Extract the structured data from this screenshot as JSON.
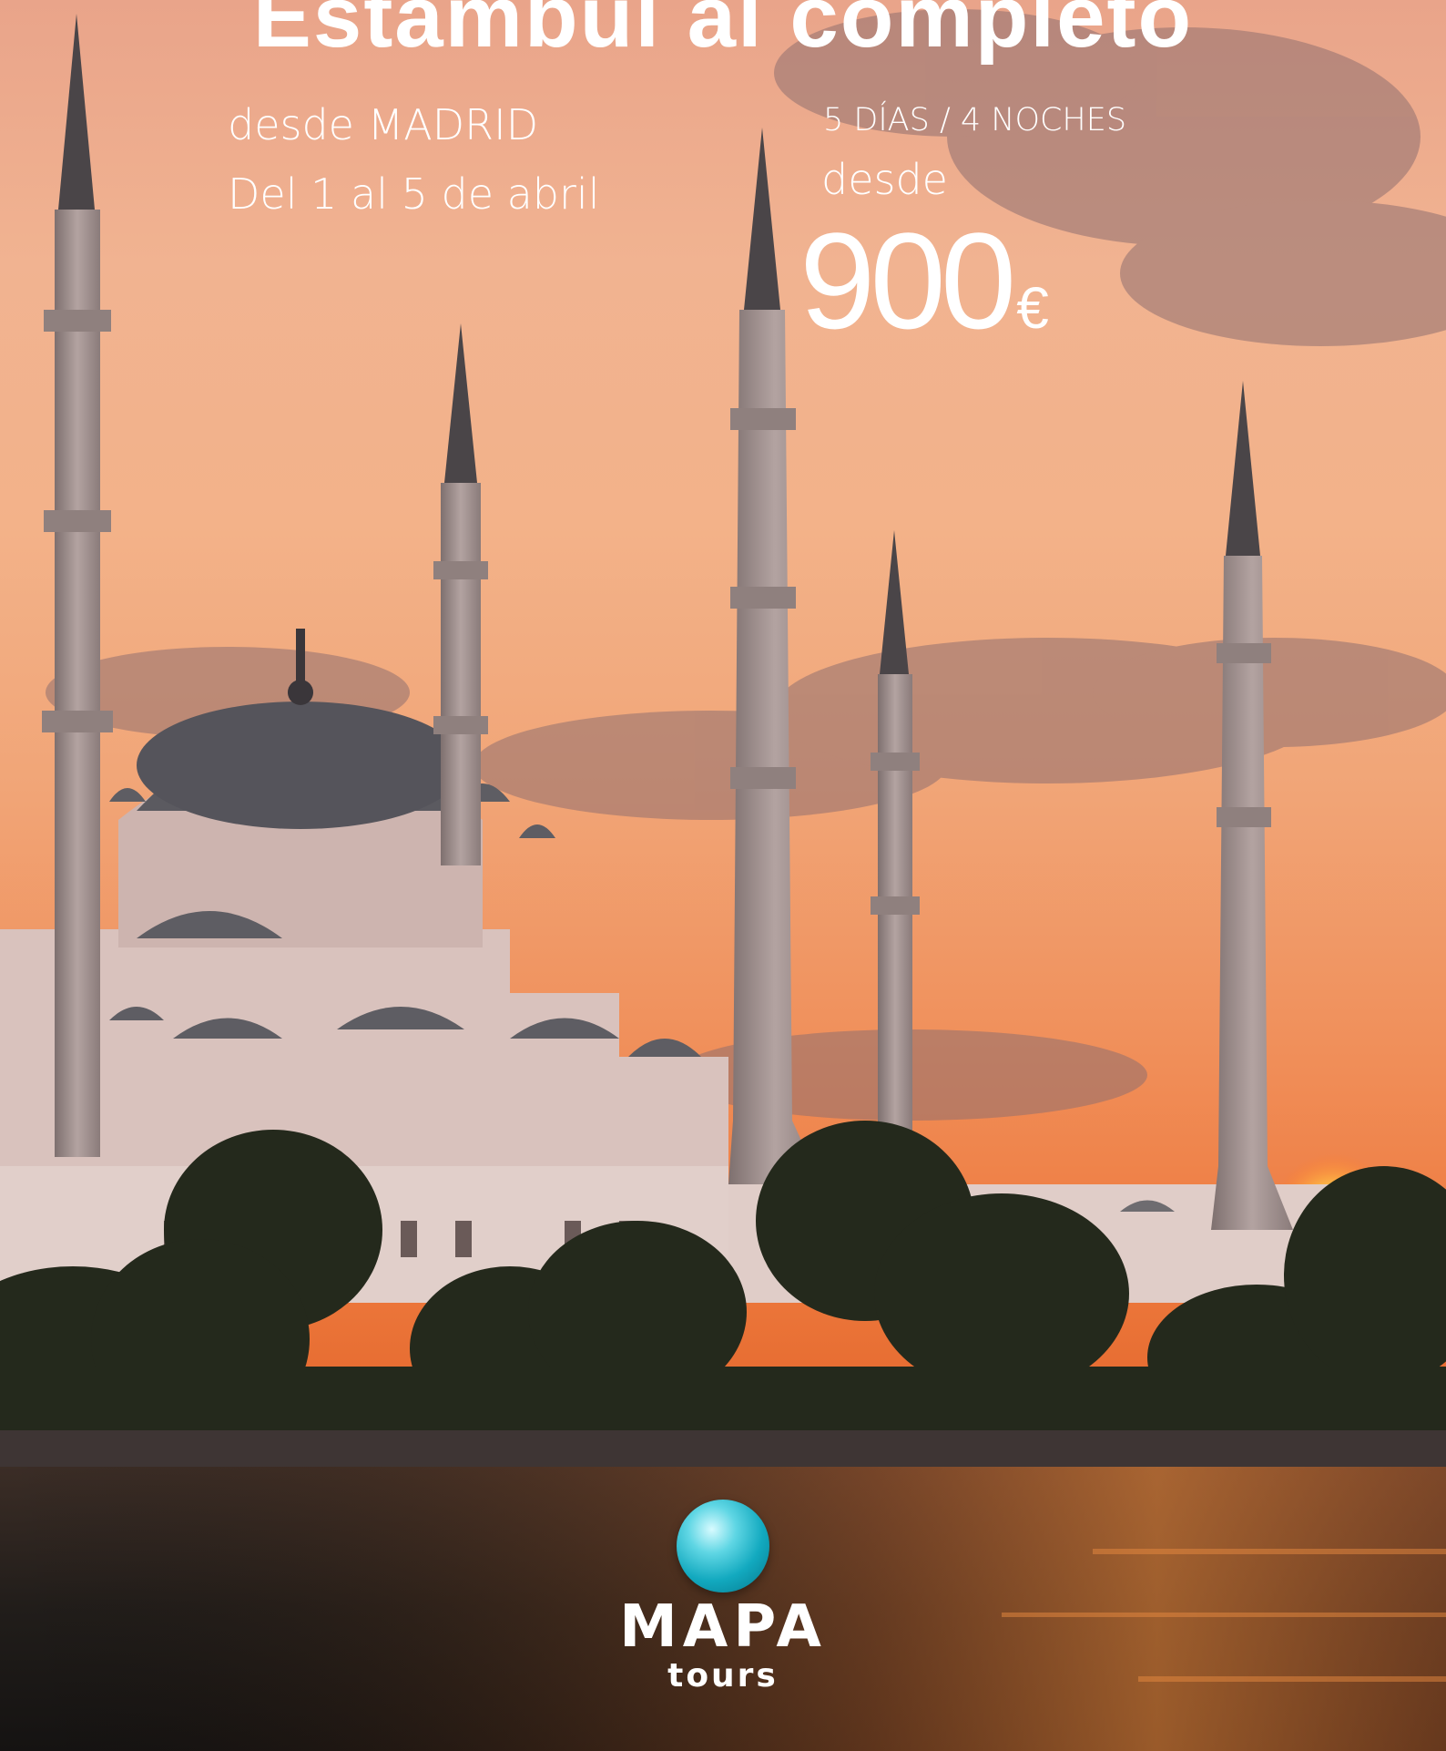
{
  "headline": {
    "title": "Estambul al completo"
  },
  "trip": {
    "origin": "desde MADRID",
    "dates": "Del 1 al 5 de abril",
    "duration": "5 DÍAS / 4 NOCHES"
  },
  "price": {
    "from_label": "desde",
    "amount": "900",
    "currency": "€"
  },
  "brand": {
    "name": "MAPA",
    "sub": "tours",
    "globe_color": "#12a9bf"
  },
  "colors": {
    "sky_top": "#e9a48a",
    "sky_sunset": "#ee7a3e",
    "sun": "#ffd24a",
    "mosque_silhouette": "#d9c2bd",
    "minaret": "#9e8e8c",
    "trees": "#24291c",
    "water": "#1d1a18"
  }
}
